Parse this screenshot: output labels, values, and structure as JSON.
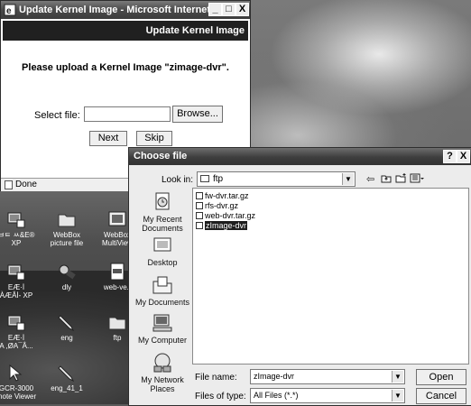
{
  "ie_window": {
    "title": "Update Kernel Image - Microsoft Internet Ex...",
    "controls": {
      "minimize": "_",
      "maximize": "□",
      "close": "X"
    },
    "header": "Update Kernel Image",
    "message": "Please upload a Kernel Image \"zimage-dvr\".",
    "select_file_label": "Select file:",
    "file_input_value": "",
    "browse_label": "Browse...",
    "next_label": "Next",
    "skip_label": "Skip",
    "status": "Done"
  },
  "desktop_icons": [
    {
      "label": "ㅂㅌ ㅆ&E®\nXP",
      "icon": "network-icon"
    },
    {
      "label": "WebBox\npicture file",
      "icon": "folder-icon"
    },
    {
      "label": "WebBox\nMultiView",
      "icon": "app-icon"
    },
    {
      "label": "EÆ·İ\nÀÆÂİ- XP",
      "icon": "network-icon"
    },
    {
      "label": "dly",
      "icon": "tools-icon"
    },
    {
      "label": "web-ve.t",
      "icon": "document-icon"
    },
    {
      "label": "EÆ·İ\nA ,ØA¯Â...",
      "icon": "network-icon"
    },
    {
      "label": "eng",
      "icon": "pen-icon"
    },
    {
      "label": "ftp",
      "icon": "folder-icon"
    },
    {
      "label": "GCR-3000\nmote Viewer",
      "icon": "viewer-icon"
    },
    {
      "label": "eng_41_1",
      "icon": "pen-icon"
    }
  ],
  "file_dialog": {
    "title": "Choose file",
    "help": "?",
    "close": "X",
    "look_in_label": "Look in:",
    "look_in_value": "ftp",
    "toolbar_icons": [
      "back-icon",
      "up-folder-icon",
      "new-folder-icon",
      "view-menu-icon"
    ],
    "places": [
      {
        "label": "My Recent\nDocuments",
        "icon": "recent-documents-icon"
      },
      {
        "label": "Desktop",
        "icon": "desktop-icon"
      },
      {
        "label": "My Documents",
        "icon": "my-documents-icon"
      },
      {
        "label": "My Computer",
        "icon": "my-computer-icon"
      },
      {
        "label": "My Network\nPlaces",
        "icon": "network-places-icon"
      }
    ],
    "files": [
      {
        "name": "fw-dvr.tar.gz",
        "selected": false
      },
      {
        "name": "rfs-dvr.gz",
        "selected": false
      },
      {
        "name": "web-dvr.tar.gz",
        "selected": false
      },
      {
        "name": "zImage-dvr",
        "selected": true
      }
    ],
    "file_name_label": "File name:",
    "file_name_value": "zImage-dvr",
    "file_type_label": "Files of type:",
    "file_type_value": "All Files (*.*)",
    "open_label": "Open",
    "cancel_label": "Cancel"
  }
}
